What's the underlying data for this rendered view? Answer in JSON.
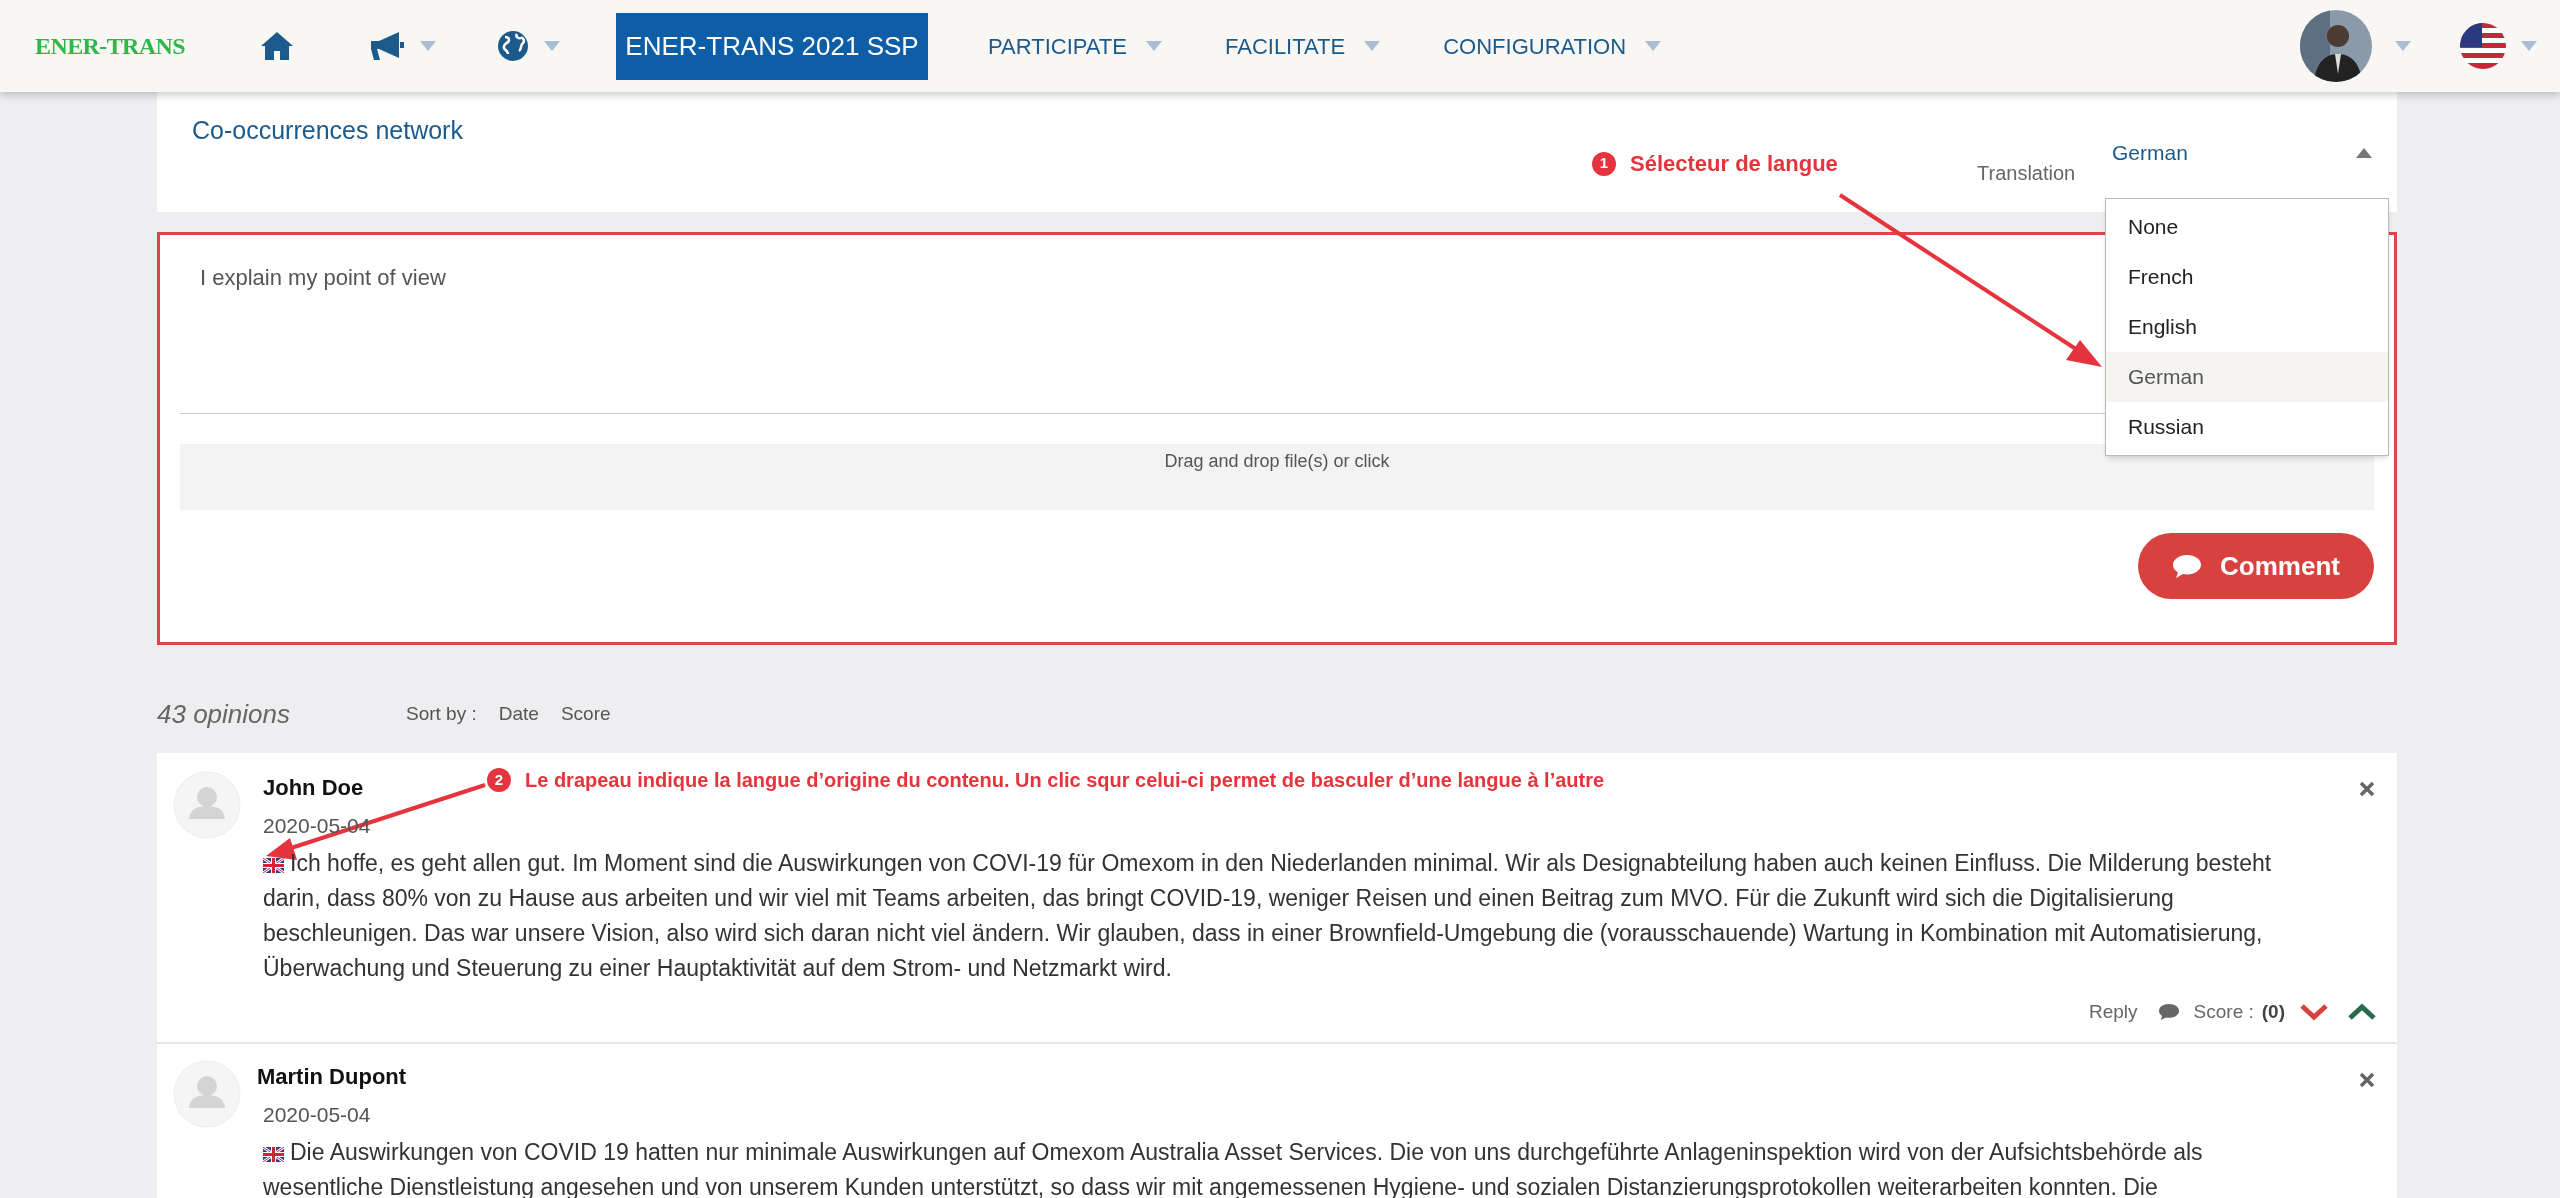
{
  "navbar": {
    "logo": "ENER-TRANS",
    "project_button": "ENER-TRANS 2021 SSP",
    "menus": [
      "PARTICIPATE",
      "FACILITATE",
      "CONFIGURATION"
    ]
  },
  "top_panel": {
    "links": [
      "Co-occurrences network"
    ],
    "translation": {
      "label": "Translation",
      "value": "German",
      "expanded": true,
      "options": [
        {
          "label": "None",
          "selected": false
        },
        {
          "label": "French",
          "selected": false
        },
        {
          "label": "English",
          "selected": false
        },
        {
          "label": "German",
          "selected": true
        },
        {
          "label": "Russian",
          "selected": false
        }
      ]
    }
  },
  "annotations": [
    {
      "number": "1",
      "text": "Sélecteur de langue"
    },
    {
      "number": "2",
      "text": "Le drapeau indique la langue d’origine du contenu. Un clic squr celui-ci permet de basculer d’une langue à l’autre"
    }
  ],
  "comment_form": {
    "value": "I explain my point of view",
    "dropzone": "Drag and drop file(s) or click",
    "button": "Comment"
  },
  "opinions": {
    "count": "43 opinions",
    "sort_label": "Sort by :",
    "sort_options": [
      "Date",
      "Score"
    ]
  },
  "comments": [
    {
      "author": "John Doe",
      "date": "2020-05-04",
      "lines": [
        "Ich hoffe, es geht allen gut. Im Moment sind die Auswirkungen von COVI-19 für Omexom in den Niederlanden minimal. Wir als Designabteilung haben auch keinen Einfluss. Die Milderung besteht",
        "darin, dass 80% von zu Hause aus arbeiten und wir viel mit Teams arbeiten, das bringt COVID-19, weniger Reisen und einen Beitrag zum MVO. Für die Zukunft wird sich die Digitalisierung",
        "beschleunigen. Das war unsere Vision, also wird sich daran nicht viel ändern. Wir glauben, dass in einer Brownfield-Umgebung die (vorausschauende) Wartung in Kombination mit Automatisierung,",
        "Überwachung und Steuerung zu einer Hauptaktivität auf dem Strom- und Netzmarkt wird."
      ],
      "reply": "Reply",
      "score_label": "Score :",
      "score": "(0)"
    },
    {
      "author": "Martin Dupont",
      "date": "2020-05-04",
      "lines": [
        "Die Auswirkungen von COVID 19 hatten nur minimale Auswirkungen auf Omexom Australia Asset Services. Die von uns durchgeführte Anlageninspektion wird von der Aufsichtsbehörde als",
        "wesentliche Dienstleistung angesehen und von unserem Kunden unterstützt, so dass wir mit angemessenen Hygiene- und sozialen Distanzierungsprotokollen weiterarbeiten konnten. Die"
      ]
    }
  ]
}
